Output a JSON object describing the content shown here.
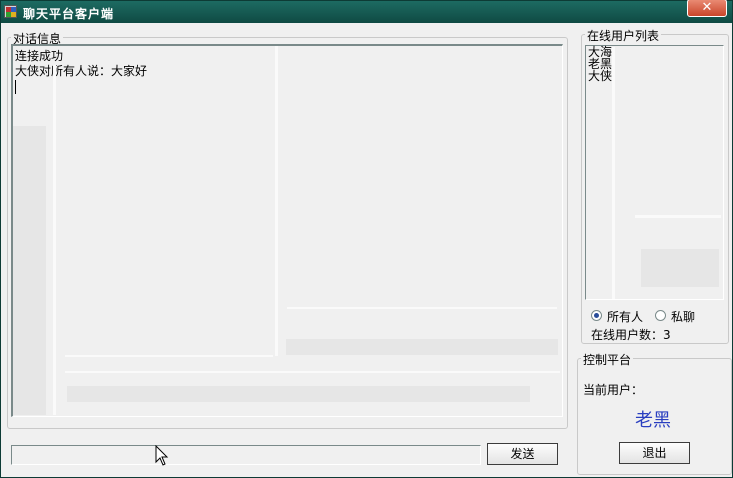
{
  "window": {
    "title": "聊天平台客户端",
    "close_symbol": "✕"
  },
  "chat": {
    "group_label": "对话信息",
    "messages": [
      "连接成功",
      "大侠对所有人说：大家好"
    ]
  },
  "online": {
    "group_label": "在线用户列表",
    "users": [
      "大海",
      "老黑",
      "大侠"
    ],
    "radio_all": "所有人",
    "radio_private": "私聊",
    "selected_mode": "所有人",
    "count_label": "在线用户数：3"
  },
  "control": {
    "group_label": "控制平台",
    "current_user_label": "当前用户：",
    "current_user_name": "老黑",
    "exit_label": "退出"
  },
  "input": {
    "value": "",
    "send_label": "发送"
  },
  "colors": {
    "titlebar": "#0f4a43",
    "username": "#2a3fc0",
    "window_bg": "#f0f0f0"
  }
}
